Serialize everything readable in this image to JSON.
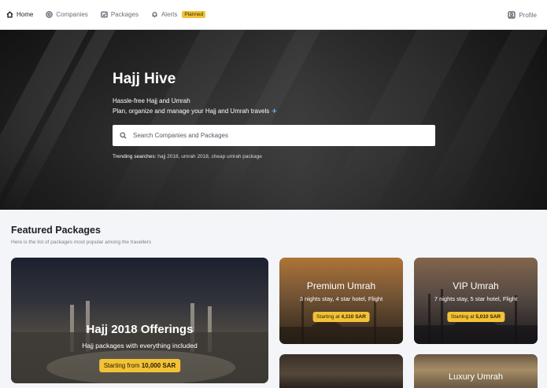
{
  "nav": {
    "items": [
      {
        "label": "Home",
        "icon": "home-icon",
        "active": true
      },
      {
        "label": "Companies",
        "icon": "companies-icon",
        "active": false
      },
      {
        "label": "Packages",
        "icon": "packages-icon",
        "active": false
      },
      {
        "label": "Alerts",
        "icon": "bell-icon",
        "active": false,
        "badge": "Planned"
      }
    ],
    "profile_label": "Profile"
  },
  "hero": {
    "title": "Hajj Hive",
    "subtitle1": "Hassle-free Hajj and Umrah",
    "subtitle2": "Plan, organize and manage your Hajj and Umrah travels",
    "plane": "✈",
    "search_placeholder": "Search Companies and Packages",
    "trending_label": "Trending searches:",
    "trending_terms": "hajj 2018, umrah 2018, cheap umrah package"
  },
  "featured": {
    "title": "Featured Packages",
    "subtitle": "Here is the list of packages most popular among the travellers",
    "cards": [
      {
        "title": "Hajj 2018 Offerings",
        "desc": "Hajj packages with everything included",
        "price_prefix": "Starting from",
        "price": "10,000 SAR"
      },
      {
        "title": "Premium Umrah",
        "desc": "3 nights stay, 4 star hotel, Flight",
        "price_prefix": "Starting at",
        "price": "4,110 SAR"
      },
      {
        "title": "VIP Umrah",
        "desc": "7 nights stay, 5 star hotel, Flight",
        "price_prefix": "Starting at",
        "price": "5,010 SAR"
      },
      {
        "title": "Luxury Umrah"
      }
    ]
  },
  "colors": {
    "accent": "#f3c236",
    "nav_bg": "#ffffff",
    "page_bg": "#f4f5f8"
  }
}
